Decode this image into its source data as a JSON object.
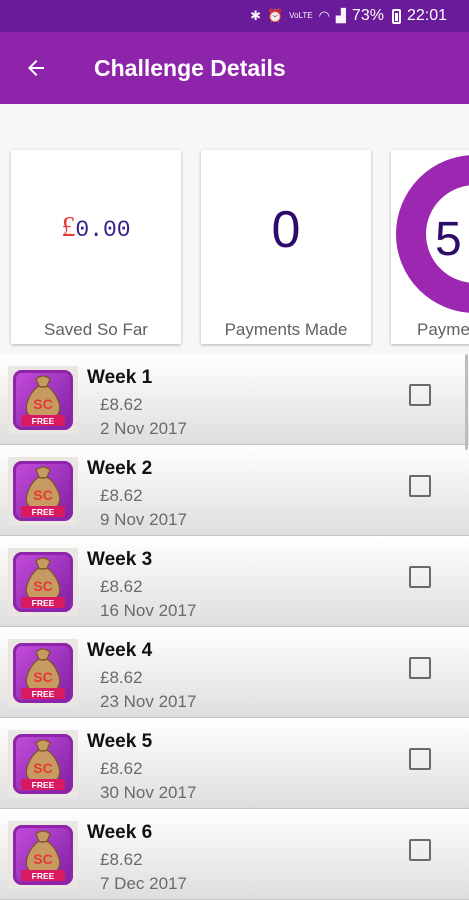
{
  "status_bar": {
    "battery_percent": "73%",
    "time": "22:01",
    "volte": "VoLTE"
  },
  "app_bar": {
    "title": "Challenge Details"
  },
  "cards": {
    "saved": {
      "currency": "£",
      "value": "0.00",
      "label": "Saved So Far"
    },
    "payments_made": {
      "value": "0",
      "label": "Payments Made"
    },
    "payments_remaining": {
      "value": "5",
      "label": "Payme"
    }
  },
  "icon": {
    "badge_text": "FREE",
    "letters": "SC"
  },
  "weeks": [
    {
      "title": "Week 1",
      "amount": "£8.62",
      "date": "2 Nov 2017",
      "checked": false
    },
    {
      "title": "Week 2",
      "amount": "£8.62",
      "date": "9 Nov 2017",
      "checked": false
    },
    {
      "title": "Week 3",
      "amount": "£8.62",
      "date": "16 Nov 2017",
      "checked": false
    },
    {
      "title": "Week 4",
      "amount": "£8.62",
      "date": "23 Nov 2017",
      "checked": false
    },
    {
      "title": "Week 5",
      "amount": "£8.62",
      "date": "30 Nov 2017",
      "checked": false
    },
    {
      "title": "Week 6",
      "amount": "£8.62",
      "date": "7 Dec 2017",
      "checked": false
    }
  ],
  "colors": {
    "status_bar": "#6a1b9a",
    "app_bar": "#8e24aa",
    "accent": "#9c27b0",
    "value_text": "#2e0a6a"
  }
}
